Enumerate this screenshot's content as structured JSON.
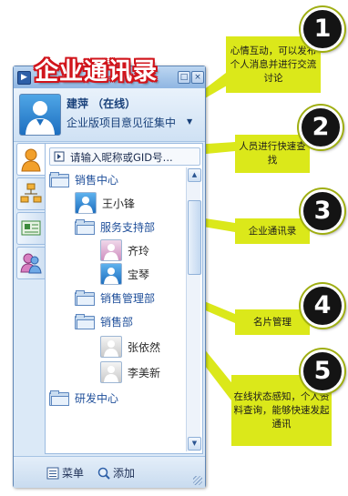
{
  "window": {
    "title": "企业通讯录",
    "controls": [
      "□",
      "×"
    ]
  },
  "profile": {
    "name": "建萍  （在线）",
    "status": "企业版项目意见征集中"
  },
  "search": {
    "placeholder": "请输入昵称或GID号..."
  },
  "tree": {
    "items": [
      {
        "type": "folder",
        "label": "销售中心"
      },
      {
        "type": "person",
        "label": "王小锋"
      },
      {
        "type": "folder",
        "label": "服务支持部"
      },
      {
        "type": "person",
        "label": "齐玲"
      },
      {
        "type": "person",
        "label": "宝琴"
      },
      {
        "type": "folder",
        "label": "销售管理部"
      },
      {
        "type": "folder",
        "label": "销售部"
      },
      {
        "type": "person",
        "label": "张依然"
      },
      {
        "type": "person",
        "label": "李美新"
      },
      {
        "type": "folder",
        "label": "研发中心"
      }
    ]
  },
  "bottom": {
    "menu_label": "菜单",
    "add_label": "添加"
  },
  "callouts": [
    {
      "number": "1",
      "text": "心情互动，可以发布个人消息并进行交流讨论"
    },
    {
      "number": "2",
      "text": "人员进行快速查找"
    },
    {
      "number": "3",
      "text": "企业通讯录"
    },
    {
      "number": "4",
      "text": "名片管理"
    },
    {
      "number": "5",
      "text": "在线状态感知，个人资料查询，能够快速发起通讯"
    }
  ],
  "colors": {
    "callout": "#dbe81a",
    "title_outline": "#d1141b",
    "window_border": "#5f86b5"
  }
}
